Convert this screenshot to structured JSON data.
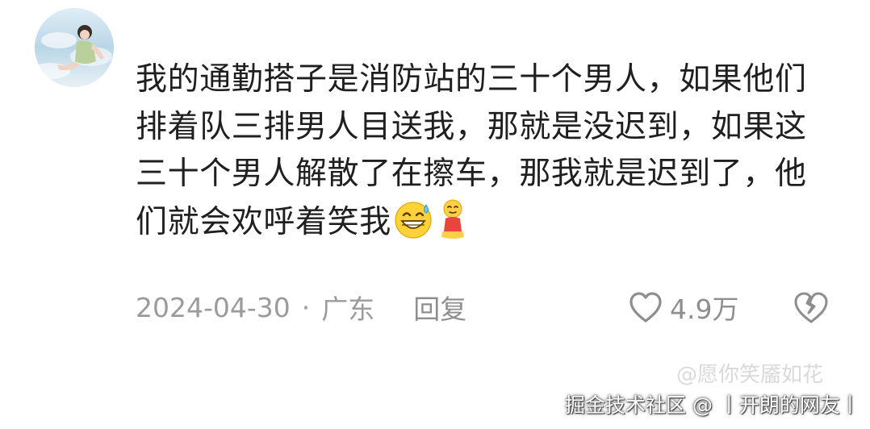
{
  "comment": {
    "lines": [
      "我的通勤搭子是消防站的三十个男人，如果他们",
      "排着队三排男人目送我，那就是没迟到，如果这",
      "三十个男人解散了在擦车，那我就是迟到了，他",
      "们就会欢呼着笑我"
    ],
    "emojis": [
      "grinning-sweat-emoji",
      "kneeling-person-emoji"
    ]
  },
  "meta": {
    "date": "2024-04-30",
    "separator": "·",
    "location": "广东",
    "reply_label": "回复"
  },
  "actions": {
    "like_count": "4.9万",
    "like_icon": "heart-outline-icon",
    "dislike_icon": "broken-heart-icon"
  },
  "watermark": {
    "source": "掘金技术社区 @ 丨开朗的网友丨",
    "faint": "@愿你笑靥如花"
  },
  "colors": {
    "text": "#1f1f1f",
    "meta": "#9b9b9b",
    "background": "#ffffff"
  }
}
